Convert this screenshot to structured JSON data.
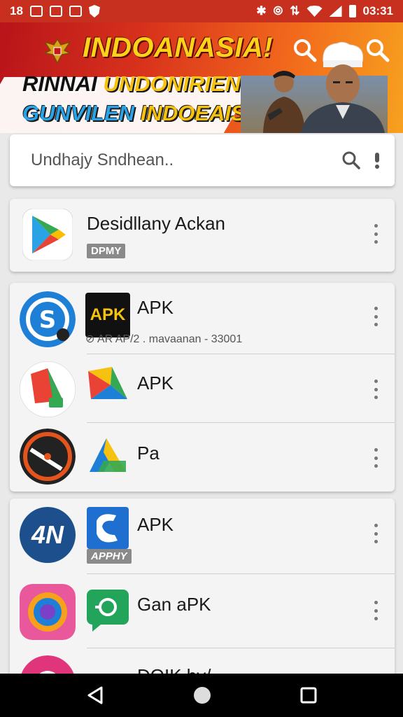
{
  "status_bar": {
    "time_left": "18",
    "time_right": "03:31",
    "icons": [
      "notification-icon",
      "image-icon",
      "app-icon",
      "shield-icon",
      "bluetooth-icon",
      "vibrate-icon",
      "data-icon",
      "wifi-icon",
      "signal-icon",
      "battery-icon"
    ]
  },
  "banner": {
    "title": "INDOANASIA!",
    "line2_a": "RINNAI",
    "line2_b": "UNDONIRIEN",
    "line3_a": "GUNVILEN",
    "line3_b": "INDOEAIS"
  },
  "search": {
    "placeholder": "Undhajy Sndhean.."
  },
  "featured": {
    "name": "Desidllany Ackan",
    "tag": "DPMY"
  },
  "group1": [
    {
      "name": "APK",
      "subtitle": "⊘ AR AP/2 . mavaanan - 33001",
      "mid_label": "APK"
    },
    {
      "name": "APK"
    },
    {
      "name": "Pa"
    }
  ],
  "group2": [
    {
      "name": "APK",
      "tag": "APPHY",
      "left_label": "4N"
    },
    {
      "name": "Gan aPK"
    },
    {
      "name": "DOIK by/"
    }
  ],
  "colors": {
    "status_bar": "#c7301f",
    "banner_yellow": "#ffd21a",
    "card_bg": "#f4f4f4"
  }
}
